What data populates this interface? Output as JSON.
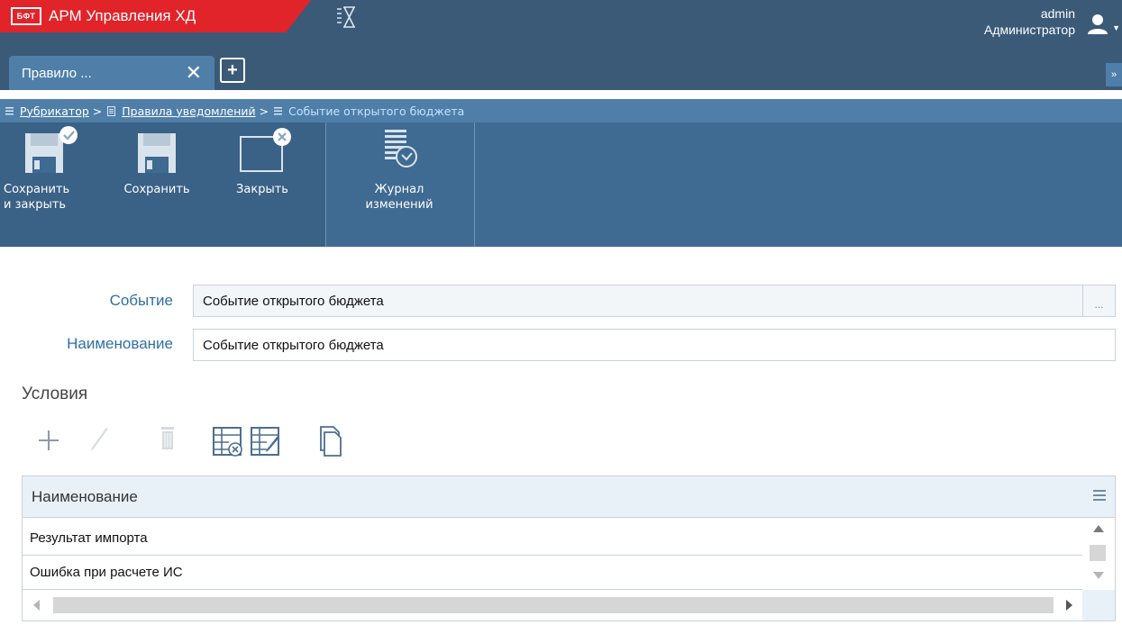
{
  "header": {
    "brand_logo": "БФТ",
    "app_title": "АРМ Управления ХД",
    "user_name": "admin",
    "user_role": "Администратор",
    "colors": {
      "brand_red": "#e1232a",
      "header_blue": "#3a5a78",
      "accent_blue": "#4f7fa9"
    }
  },
  "tabs": {
    "items": [
      {
        "label": "Правило ..."
      }
    ],
    "close_glyph": "✕",
    "add_glyph": "+",
    "overflow_glyph": "»"
  },
  "breadcrumb": {
    "items": [
      {
        "label": "Рубрикатор",
        "icon": "list-icon",
        "link": true
      },
      {
        "label": "Правила уведомлений",
        "icon": "document-icon",
        "link": true
      },
      {
        "label": "Событие открытого бюджета",
        "icon": "list-icon",
        "link": false
      }
    ],
    "separator": ">"
  },
  "toolbar": {
    "save_close_line1": "Сохранить",
    "save_close_line2": "и закрыть",
    "save": "Сохранить",
    "close": "Закрыть",
    "journal_line1": "Журнал",
    "journal_line2": "изменений"
  },
  "form": {
    "event_label": "Событие",
    "event_value": "Событие открытого бюджета",
    "event_button": "...",
    "name_label": "Наименование",
    "name_value": "Событие открытого бюджета"
  },
  "conditions": {
    "title": "Условия",
    "toolbar_icons": [
      "add-icon",
      "edit-icon",
      "delete-icon",
      "table-remove-icon",
      "table-edit-icon",
      "copy-icon"
    ],
    "columns": [
      "Наименование"
    ],
    "rows": [
      {
        "name": "Результат импорта"
      },
      {
        "name": "Ошибка при расчете ИС"
      }
    ]
  }
}
